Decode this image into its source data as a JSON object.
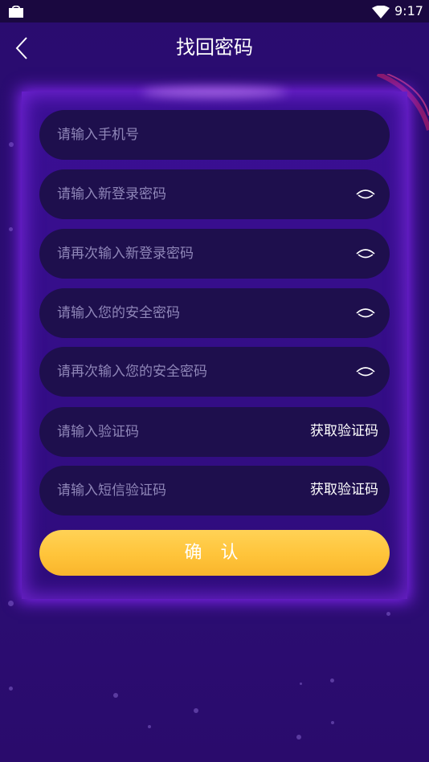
{
  "status_bar": {
    "time": "9:17"
  },
  "header": {
    "title": "找回密码",
    "back_icon": "chevron-left-icon"
  },
  "form": {
    "fields": [
      {
        "placeholder": "请输入手机号",
        "icon": null
      },
      {
        "placeholder": "请输入新登录密码",
        "icon": "eye-icon"
      },
      {
        "placeholder": "请再次输入新登录密码",
        "icon": "eye-icon"
      },
      {
        "placeholder": "请输入您的安全密码",
        "icon": "eye-icon"
      },
      {
        "placeholder": "请再次输入您的安全密码",
        "icon": "eye-icon"
      },
      {
        "placeholder": "请输入验证码",
        "action": "获取验证码"
      },
      {
        "placeholder": "请输入短信验证码",
        "action": "获取验证码"
      }
    ],
    "confirm_label": "确 认"
  },
  "colors": {
    "background": "#2b0d72",
    "card": "#3b0f95",
    "field": "#1e0f4d",
    "placeholder": "#8f86b8",
    "confirm": "#ffc43a",
    "glow": "#8c28ff"
  }
}
